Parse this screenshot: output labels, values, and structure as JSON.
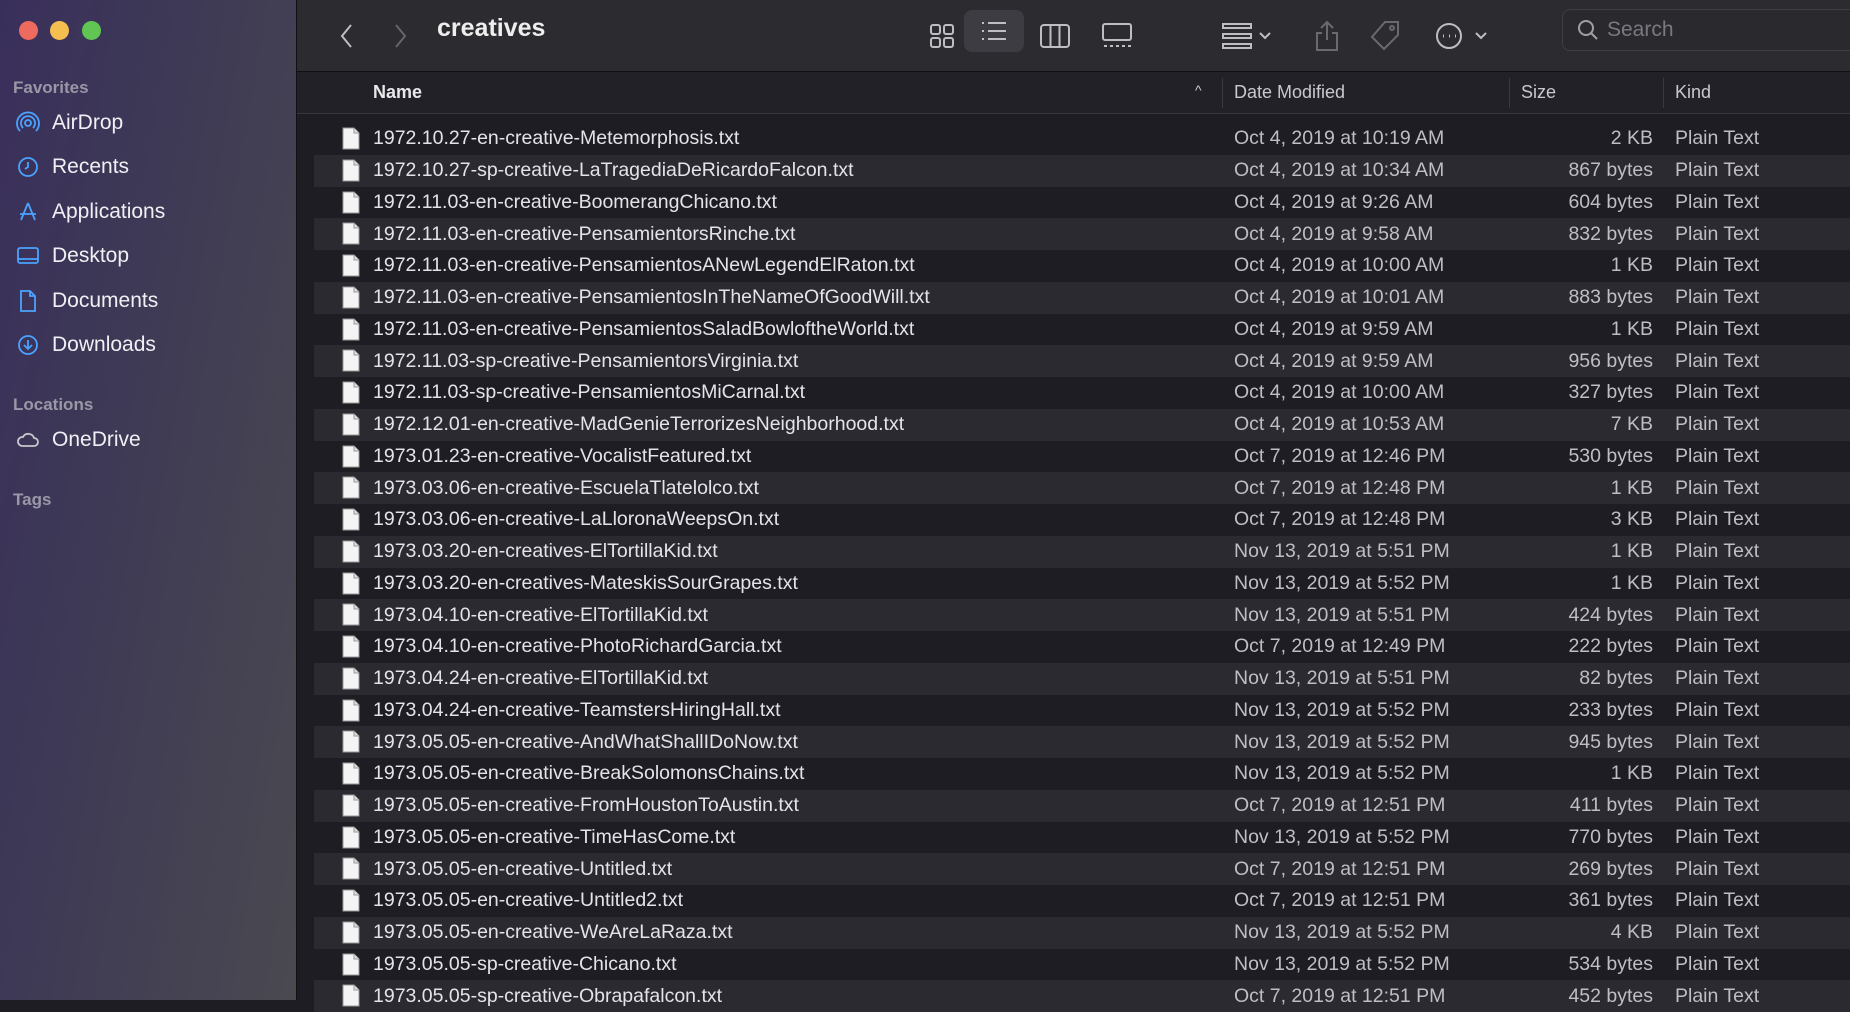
{
  "window": {
    "title": "creatives"
  },
  "sidebar": {
    "favorites_label": "Favorites",
    "favorites": [
      {
        "label": "AirDrop",
        "icon": "airdrop-icon"
      },
      {
        "label": "Recents",
        "icon": "clock-icon"
      },
      {
        "label": "Applications",
        "icon": "applications-icon"
      },
      {
        "label": "Desktop",
        "icon": "desktop-icon"
      },
      {
        "label": "Documents",
        "icon": "document-icon"
      },
      {
        "label": "Downloads",
        "icon": "download-icon"
      }
    ],
    "locations_label": "Locations",
    "locations": [
      {
        "label": "OneDrive",
        "icon": "cloud-icon"
      }
    ],
    "tags_label": "Tags"
  },
  "toolbar": {
    "search_placeholder": "Search",
    "view_mode": "list"
  },
  "columns": {
    "name": "Name",
    "date": "Date Modified",
    "size": "Size",
    "kind": "Kind",
    "sort": "name-ascending"
  },
  "files": [
    [
      "1972.10.27-en-creative-Metemorphosis.txt",
      "Oct 4, 2019 at 10:19 AM",
      "2 KB",
      "Plain Text"
    ],
    [
      "1972.10.27-sp-creative-LaTragediaDeRicardoFalcon.txt",
      "Oct 4, 2019 at 10:34 AM",
      "867 bytes",
      "Plain Text"
    ],
    [
      "1972.11.03-en-creative-BoomerangChicano.txt",
      "Oct 4, 2019 at 9:26 AM",
      "604 bytes",
      "Plain Text"
    ],
    [
      "1972.11.03-en-creative-PensamientorsRinche.txt",
      "Oct 4, 2019 at 9:58 AM",
      "832 bytes",
      "Plain Text"
    ],
    [
      "1972.11.03-en-creative-PensamientosANewLegendElRaton.txt",
      "Oct 4, 2019 at 10:00 AM",
      "1 KB",
      "Plain Text"
    ],
    [
      "1972.11.03-en-creative-PensamientosInTheNameOfGoodWill.txt",
      "Oct 4, 2019 at 10:01 AM",
      "883 bytes",
      "Plain Text"
    ],
    [
      "1972.11.03-en-creative-PensamientosSaladBowloftheWorld.txt",
      "Oct 4, 2019 at 9:59 AM",
      "1 KB",
      "Plain Text"
    ],
    [
      "1972.11.03-sp-creative-PensamientorsVirginia.txt",
      "Oct 4, 2019 at 9:59 AM",
      "956 bytes",
      "Plain Text"
    ],
    [
      "1972.11.03-sp-creative-PensamientosMiCarnal.txt",
      "Oct 4, 2019 at 10:00 AM",
      "327 bytes",
      "Plain Text"
    ],
    [
      "1972.12.01-en-creative-MadGenieTerrorizesNeighborhood.txt",
      "Oct 4, 2019 at 10:53 AM",
      "7 KB",
      "Plain Text"
    ],
    [
      "1973.01.23-en-creative-VocalistFeatured.txt",
      "Oct 7, 2019 at 12:46 PM",
      "530 bytes",
      "Plain Text"
    ],
    [
      "1973.03.06-en-creative-EscuelaTlatelolco.txt",
      "Oct 7, 2019 at 12:48 PM",
      "1 KB",
      "Plain Text"
    ],
    [
      "1973.03.06-en-creative-LaLloronaWeepsOn.txt",
      "Oct 7, 2019 at 12:48 PM",
      "3 KB",
      "Plain Text"
    ],
    [
      "1973.03.20-en-creatives-ElTortillaKid.txt",
      "Nov 13, 2019 at 5:51 PM",
      "1 KB",
      "Plain Text"
    ],
    [
      "1973.03.20-en-creatives-MateskisSourGrapes.txt",
      "Nov 13, 2019 at 5:52 PM",
      "1 KB",
      "Plain Text"
    ],
    [
      "1973.04.10-en-creative-ElTortillaKid.txt",
      "Nov 13, 2019 at 5:51 PM",
      "424 bytes",
      "Plain Text"
    ],
    [
      "1973.04.10-en-creative-PhotoRichardGarcia.txt",
      "Oct 7, 2019 at 12:49 PM",
      "222 bytes",
      "Plain Text"
    ],
    [
      "1973.04.24-en-creative-ElTortillaKid.txt",
      "Nov 13, 2019 at 5:51 PM",
      "82 bytes",
      "Plain Text"
    ],
    [
      "1973.04.24-en-creative-TeamstersHiringHall.txt",
      "Nov 13, 2019 at 5:52 PM",
      "233 bytes",
      "Plain Text"
    ],
    [
      "1973.05.05-en-creative-AndWhatShallIDoNow.txt",
      "Nov 13, 2019 at 5:52 PM",
      "945 bytes",
      "Plain Text"
    ],
    [
      "1973.05.05-en-creative-BreakSolomonsChains.txt",
      "Nov 13, 2019 at 5:52 PM",
      "1 KB",
      "Plain Text"
    ],
    [
      "1973.05.05-en-creative-FromHoustonToAustin.txt",
      "Oct 7, 2019 at 12:51 PM",
      "411 bytes",
      "Plain Text"
    ],
    [
      "1973.05.05-en-creative-TimeHasCome.txt",
      "Nov 13, 2019 at 5:52 PM",
      "770 bytes",
      "Plain Text"
    ],
    [
      "1973.05.05-en-creative-Untitled.txt",
      "Oct 7, 2019 at 12:51 PM",
      "269 bytes",
      "Plain Text"
    ],
    [
      "1973.05.05-en-creative-Untitled2.txt",
      "Oct 7, 2019 at 12:51 PM",
      "361 bytes",
      "Plain Text"
    ],
    [
      "1973.05.05-en-creative-WeAreLaRaza.txt",
      "Nov 13, 2019 at 5:52 PM",
      "4 KB",
      "Plain Text"
    ],
    [
      "1973.05.05-sp-creative-Chicano.txt",
      "Nov 13, 2019 at 5:52 PM",
      "534 bytes",
      "Plain Text"
    ],
    [
      "1973.05.05-sp-creative-Obrapafalcon.txt",
      "Oct 7, 2019 at 12:51 PM",
      "452 bytes",
      "Plain Text"
    ]
  ]
}
